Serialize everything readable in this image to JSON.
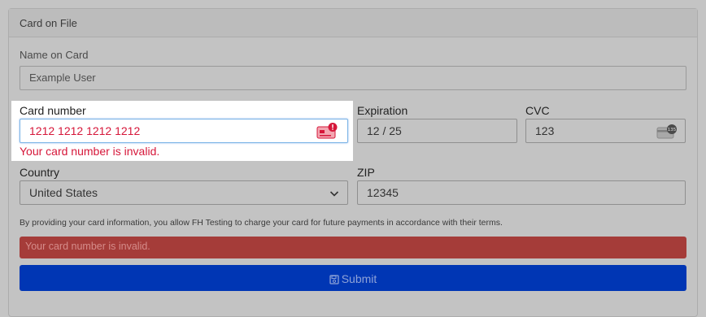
{
  "panel": {
    "title": "Card on File"
  },
  "name_on_card": {
    "label": "Name on Card",
    "value": "Example User"
  },
  "card_number": {
    "label": "Card number",
    "value": "1212 1212 1212 1212",
    "error": "Your card number is invalid."
  },
  "expiration": {
    "label": "Expiration",
    "value": "12 / 25"
  },
  "cvc": {
    "label": "CVC",
    "value": "123",
    "icon_text": "135"
  },
  "country": {
    "label": "Country",
    "value": "United States"
  },
  "zip": {
    "label": "ZIP",
    "value": "12345"
  },
  "terms": "By providing your card information, you allow FH Testing to charge your card for future payments in accordance with their terms.",
  "alert": {
    "text": "Your card number is invalid."
  },
  "submit": {
    "label": "Submit"
  },
  "colors": {
    "error": "#d6173a",
    "alert_bg": "#a53c39",
    "submit_bg": "#0036b4",
    "focus_border": "#7ab3e6"
  }
}
